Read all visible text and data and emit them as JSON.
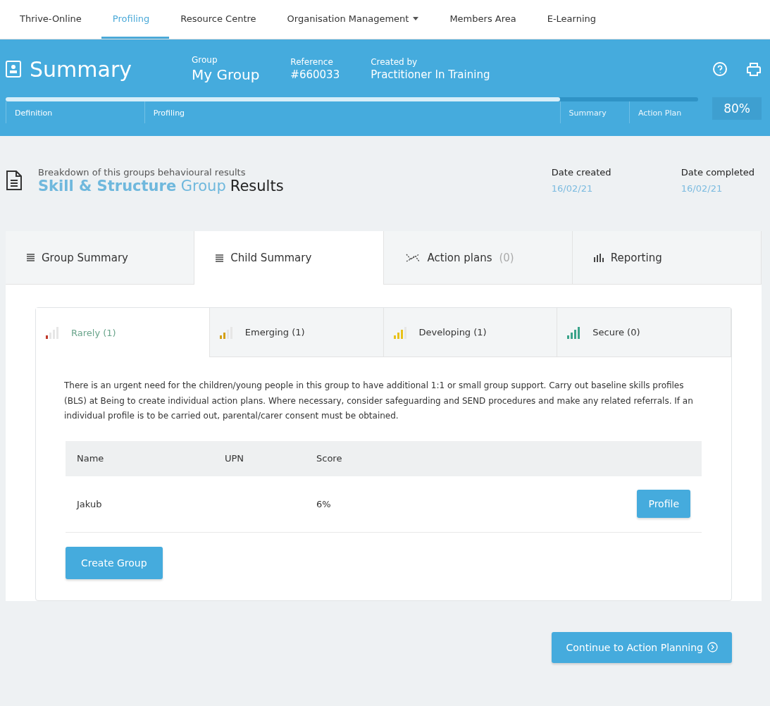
{
  "nav": [
    {
      "label": "Thrive-Online",
      "selected": false,
      "dropdown": false
    },
    {
      "label": "Profiling",
      "selected": true,
      "dropdown": false
    },
    {
      "label": "Resource Centre",
      "selected": false,
      "dropdown": false
    },
    {
      "label": "Organisation Management",
      "selected": false,
      "dropdown": true
    },
    {
      "label": "Members Area",
      "selected": false,
      "dropdown": false
    },
    {
      "label": "E-Learning",
      "selected": false,
      "dropdown": false
    }
  ],
  "header": {
    "title": "Summary",
    "group_label": "Group",
    "group": "My Group",
    "reference_label": "Reference",
    "reference": "#660033",
    "created_label": "Created by",
    "created_by": "Practitioner In Training",
    "progress": {
      "level": 0.8,
      "reading": "80%",
      "stages": [
        {
          "label": "Definition",
          "done": true
        },
        {
          "label": "Profiling",
          "done": true
        },
        {
          "label": "Summary",
          "done": false
        },
        {
          "label": "Action Plan",
          "done": false
        }
      ]
    }
  },
  "results": {
    "subtitle": "Breakdown of this groups behavioural results",
    "title": "**Skill & Structure** Group",
    "title_suffix": "Results",
    "date_created_label": "Date created",
    "date_created": "16/02/21",
    "date_completed_label": "Date completed",
    "date_completed": "16/02/21"
  },
  "tabs": [
    {
      "label": "Group Summary",
      "kind": "list",
      "selected": false
    },
    {
      "label": "Child Summary",
      "kind": "list",
      "selected": true
    },
    {
      "label": "Action plans",
      "count": "(0)",
      "kind": "plan",
      "selected": false
    },
    {
      "label": "Reporting",
      "kind": "chart",
      "selected": false
    }
  ],
  "levels": [
    {
      "label": "Rarely (1)",
      "kind": "low",
      "color": "#c0392b",
      "selected": true
    },
    {
      "label": "Emerging (1)",
      "kind": "medium",
      "color": "#d4a017",
      "selected": false
    },
    {
      "label": "Developing (1)",
      "kind": "high",
      "color": "#e8c21a",
      "selected": false
    },
    {
      "label": "Secure (0)",
      "kind": "full",
      "color": "#3aa38a",
      "selected": false
    }
  ],
  "description": "There is an urgent need for the children/young people in this group to have additional 1:1 or small group support. Carry out baseline skills profiles (BLS) at Being to create individual action plans. Where necessary, consider safeguarding and SEND procedures and make any related referrals. If an individual profile is to be carried out, parental/carer consent must be obtained.",
  "table": {
    "columns": [
      "Name",
      "UPN",
      "Score"
    ],
    "rows": [
      {
        "name": "Jakub",
        "score": "6%",
        "action": "Profile"
      }
    ]
  },
  "create_button": "Create Group",
  "continue_button": "Continue to Action Planning"
}
